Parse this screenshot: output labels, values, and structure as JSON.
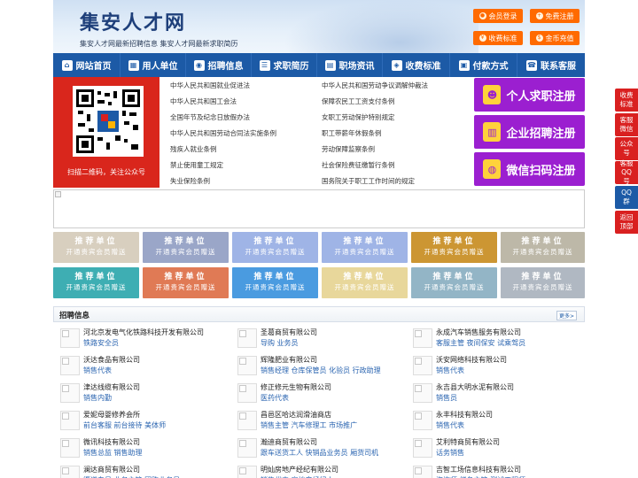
{
  "header": {
    "title": "集安人才网",
    "subtitle": "集安人才网最新招聘信息   集安人才网最新求职简历",
    "buttons": [
      {
        "label": "会员登录",
        "icon": "user-icon"
      },
      {
        "label": "免费注册",
        "icon": "user-add-icon"
      },
      {
        "label": "收费标准",
        "icon": "price-icon"
      },
      {
        "label": "金币充值",
        "icon": "coin-icon"
      }
    ]
  },
  "nav": [
    {
      "label": "网站首页",
      "icon": "home-icon"
    },
    {
      "label": "用人单位",
      "icon": "building-icon"
    },
    {
      "label": "招聘信息",
      "icon": "broadcast-icon"
    },
    {
      "label": "求职简历",
      "icon": "resume-icon"
    },
    {
      "label": "职场资讯",
      "icon": "news-icon"
    },
    {
      "label": "收费标准",
      "icon": "fee-icon"
    },
    {
      "label": "付款方式",
      "icon": "payment-icon"
    },
    {
      "label": "联系客服",
      "icon": "phone-icon"
    }
  ],
  "qr": {
    "caption": "扫描二维码，关注公众号"
  },
  "laws": [
    "中华人民共和国就业促进法",
    "中华人民共和国劳动争议调解仲裁法",
    "中华人民共和国工会法",
    "保障农民工工资支付条例",
    "全国年节及纪念日放假办法",
    "女职工劳动保护特别规定",
    "中华人民共和国劳动合同法实施条例",
    "职工带薪年休假条例",
    "残疾人就业条例",
    "劳动保障监察条例",
    "禁止使用童工规定",
    "社会保险费征缴暂行条例",
    "失业保险条例",
    "国务院关于职工工作时间的规定"
  ],
  "register": [
    {
      "label": "个人求职注册",
      "icon": "person-icon"
    },
    {
      "label": "企业招聘注册",
      "icon": "company-icon"
    },
    {
      "label": "微信扫码注册",
      "icon": "wechat-icon"
    }
  ],
  "vip": {
    "title": "推荐单位",
    "subtitle": "开通贵宾会员赠送"
  },
  "vip_colors": [
    "#d8cfbf",
    "#9aa6c8",
    "#9fb4e6",
    "#9fb4e6",
    "#cc9633",
    "#bdb8a8",
    "#3eaeb3",
    "#e07a55",
    "#4a9be0",
    "#e8d79b",
    "#93b5c6",
    "#b0b8c2"
  ],
  "jobs": {
    "title": "招聘信息",
    "more": "更多>",
    "items": [
      {
        "company": "河北京发电气化铁路科技开发有限公司",
        "positions": "铁路安全员"
      },
      {
        "company": "圣葛商贸有限公司",
        "positions": "导购 业务员"
      },
      {
        "company": "永成汽车销售服务有限公司",
        "positions": "客服主管 夜间保安 试乘驾员"
      },
      {
        "company": "沃达食品有限公司",
        "positions": "销售代表"
      },
      {
        "company": "辉隆肥业有限公司",
        "positions": "销售经理 仓库保管员 化验员 行政助理"
      },
      {
        "company": "沃安网络科技有限公司",
        "positions": "销售代表"
      },
      {
        "company": "津达线缆有限公司",
        "positions": "销售内勤"
      },
      {
        "company": "修正修元生物有限公司",
        "positions": "医药代表"
      },
      {
        "company": "永吉县大明水泥有限公司",
        "positions": "销售员"
      },
      {
        "company": "爱妮母婴修养会所",
        "positions": "前台客服 前台接待 美体师"
      },
      {
        "company": "昌邑区哈达润滑油商店",
        "positions": "销售主管 汽车修理工 市场推广"
      },
      {
        "company": "永丰科技有限公司",
        "positions": "销售代表"
      },
      {
        "company": "微讯科技有限公司",
        "positions": "销售总监 销售助理"
      },
      {
        "company": "瀚迪商贸有限公司",
        "positions": "跟车送货工人 快销品业务员 厢货司机"
      },
      {
        "company": "艾利特商贸有限公司",
        "positions": "话务销售"
      },
      {
        "company": "澜达商贸有限公司",
        "positions": "渠道专员 业务主管 团购业务员"
      },
      {
        "company": "明灿房地产经纪有限公司",
        "positions": "销售代表 房地产经纪人"
      },
      {
        "company": "吉智工场信息科技有限公司",
        "positions": "咨询师 储备主管 测试工程师"
      }
    ]
  },
  "float": [
    {
      "label": "收费标准",
      "color": "#d92020"
    },
    {
      "label": "客服微信",
      "color": "#d92020"
    },
    {
      "label": "公众号",
      "color": "#d92020"
    },
    {
      "label": "客服QQ号",
      "color": "#d92020"
    },
    {
      "label": "QQ群",
      "color": "#1c5aa6"
    },
    {
      "label": "返回顶部",
      "color": "#d92020"
    }
  ]
}
